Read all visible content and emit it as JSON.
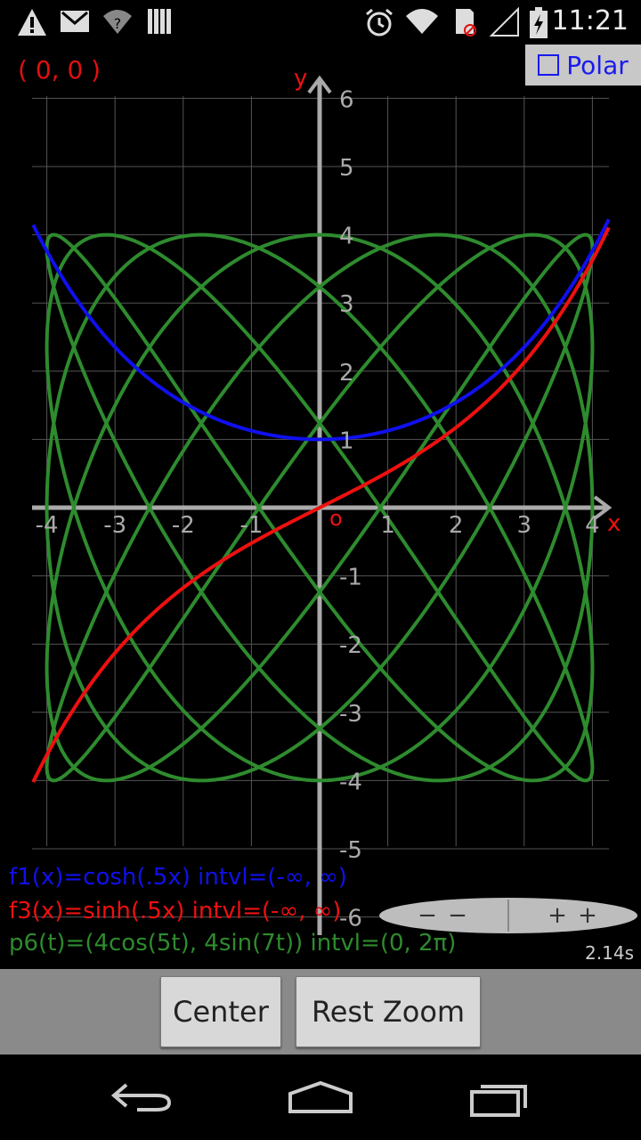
{
  "status_bar": {
    "time": "11:21",
    "left_icons": [
      "warning-icon",
      "gmail-icon",
      "wifi-question-icon",
      "signal-bars-icon"
    ],
    "right_icons": [
      "alarm-icon",
      "wifi-icon",
      "sd-card-icon",
      "cell-signal-icon",
      "battery-charging-icon"
    ]
  },
  "graph": {
    "coord_readout": "( 0, 0 )",
    "polar_label": "Polar",
    "polar_checked": false,
    "axis_x_label": "x",
    "axis_y_label": "y",
    "origin_label": "o",
    "x_ticks": [
      "-4",
      "-3",
      "-2",
      "-1",
      "1",
      "2",
      "3",
      "4"
    ],
    "y_ticks": [
      "6",
      "5",
      "4",
      "3",
      "2",
      "1",
      "-1",
      "-2",
      "-3",
      "-4",
      "-5",
      "-6"
    ],
    "colors": {
      "f1": "#1010ee",
      "f3": "#ee1010",
      "p6": "#2e8b2e",
      "axis": "#aaaaaa",
      "grid": "#555555"
    }
  },
  "functions": {
    "f1": "f1(x)=cosh(.5x)   intvl=(-∞, ∞)",
    "f3": "f3(x)=sinh(.5x)   intvl=(-∞, ∞)",
    "p6": "p6(t)=(4cos(5t), 4sin(7t))   intvl=(0,  2π)"
  },
  "zoom": {
    "out_label": "− −",
    "in_label": "+ +"
  },
  "timing": "2.14s",
  "buttons": {
    "center": "Center",
    "reset_zoom": "Rest Zoom"
  },
  "nav": {
    "icons": [
      "back-icon",
      "home-icon",
      "recents-icon"
    ]
  }
}
